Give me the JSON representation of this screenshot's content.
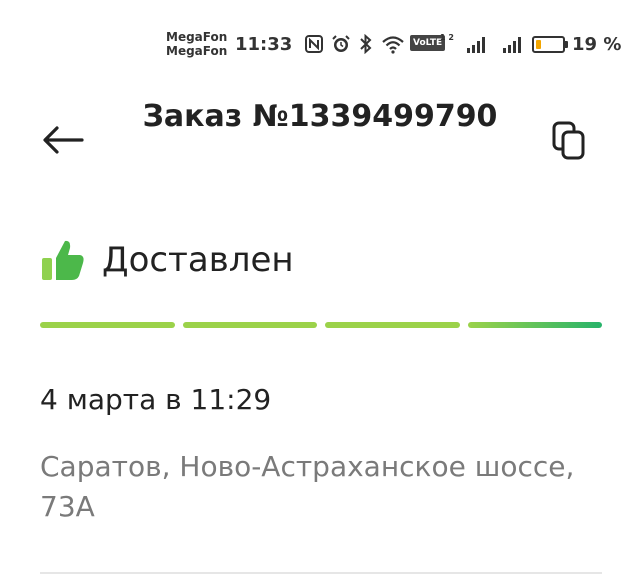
{
  "status_bar": {
    "carrier_1": "MegaFon",
    "carrier_2": "MegaFon",
    "time": "11:33",
    "volte": "VoLTE",
    "volte_sub": "1 2",
    "battery_percent_text": "19 %",
    "battery_level": 0.19,
    "icons": [
      "nfc-icon",
      "alarm-icon",
      "bluetooth-icon",
      "wifi-icon",
      "volte-icon",
      "signal-icon",
      "signal-icon",
      "battery-icon"
    ]
  },
  "header": {
    "back_icon": "arrow-left-icon",
    "title": "Заказ №1339499790",
    "copy_icon": "copy-icon"
  },
  "order": {
    "status_icon": "thumbs-up-icon",
    "status": "Доставлен",
    "progress_segments": 4,
    "progress_completed": 4,
    "date": "4 марта в 11:29",
    "address": "Саратов, Ново-Астраханское шоссе, 73А"
  },
  "colors": {
    "progress_start": "#9bd24a",
    "progress_end": "#27b36a",
    "thumb_green": "#4cb84a",
    "address_gray": "#7a7a7a"
  }
}
